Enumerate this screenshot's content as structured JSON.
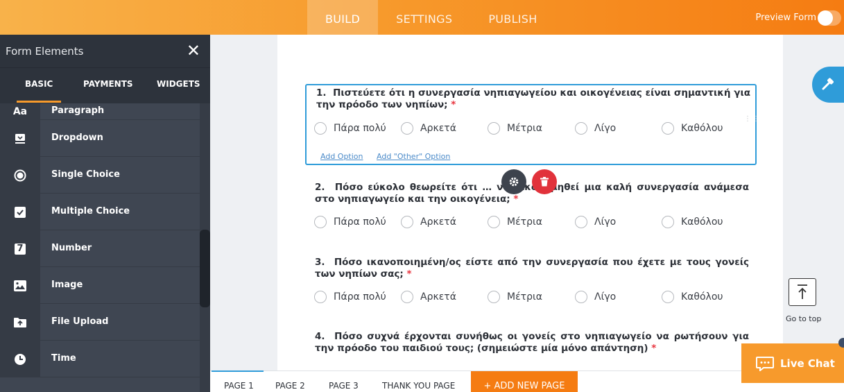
{
  "header": {
    "tabs": [
      {
        "label": "BUILD",
        "active": true
      },
      {
        "label": "SETTINGS",
        "active": false
      },
      {
        "label": "PUBLISH",
        "active": false
      }
    ],
    "preview_label": "Preview Form"
  },
  "sidebar": {
    "title": "Form Elements",
    "close_icon": "close-icon",
    "tabs": [
      "BASIC",
      "PAYMENTS",
      "WIDGETS"
    ],
    "items": [
      {
        "label": "Paragraph",
        "icon": "paragraph-icon",
        "glyph": "Aa"
      },
      {
        "label": "Dropdown",
        "icon": "dropdown-icon"
      },
      {
        "label": "Single Choice",
        "icon": "radio-icon"
      },
      {
        "label": "Multiple Choice",
        "icon": "checkbox-icon"
      },
      {
        "label": "Number",
        "icon": "number-icon",
        "glyph": "7"
      },
      {
        "label": "Image",
        "icon": "image-icon"
      },
      {
        "label": "File Upload",
        "icon": "upload-icon"
      },
      {
        "label": "Time",
        "icon": "clock-icon"
      }
    ]
  },
  "options": [
    "Πάρα πολύ",
    "Αρκετά",
    "Μέτρια",
    "Λίγο",
    "Καθόλου"
  ],
  "questions": [
    {
      "number": "1.",
      "text": "Πιστεύετε ότι η συνεργασία νηπιαγωγείου και οικογένειας είναι σημαντική για την πρόοδο των νηπίων;",
      "required": "*"
    },
    {
      "number": "2.",
      "text": "Πόσο εύκολο θεωρείτε ότι … να οικοδομηθεί μια καλή συνεργασία ανάμεσα στο νηπιαγωγείο και την οικογένεια;",
      "required": "*"
    },
    {
      "number": "3.",
      "text": "Πόσο ικανοποιημένη/ος είστε από την συνεργασία που έχετε με τους γονείς των νηπίων σας;",
      "required": "*"
    },
    {
      "number": "4.",
      "text": "Πόσο συχνά έρχονται συνήθως οι γονείς στο νηπιαγωγείο να ρωτήσουν για την πρόοδο του παιδιού τους; (σημειώστε μία μόνο απάντηση)",
      "required": "*"
    }
  ],
  "question_links": {
    "add_option": "Add Option",
    "add_other": "Add \"Other\" Option"
  },
  "pages": {
    "tabs": [
      "PAGE 1",
      "PAGE 2",
      "PAGE 3",
      "THANK YOU PAGE"
    ],
    "add_label": "+ ADD NEW PAGE"
  },
  "right_widgets": {
    "go_to_top": "Go to top",
    "live_chat": "Live Chat"
  },
  "colors": {
    "accent": "#f79a2c",
    "selected": "#2f9cd9",
    "required": "#e8333d",
    "delete": "#e1323b"
  }
}
